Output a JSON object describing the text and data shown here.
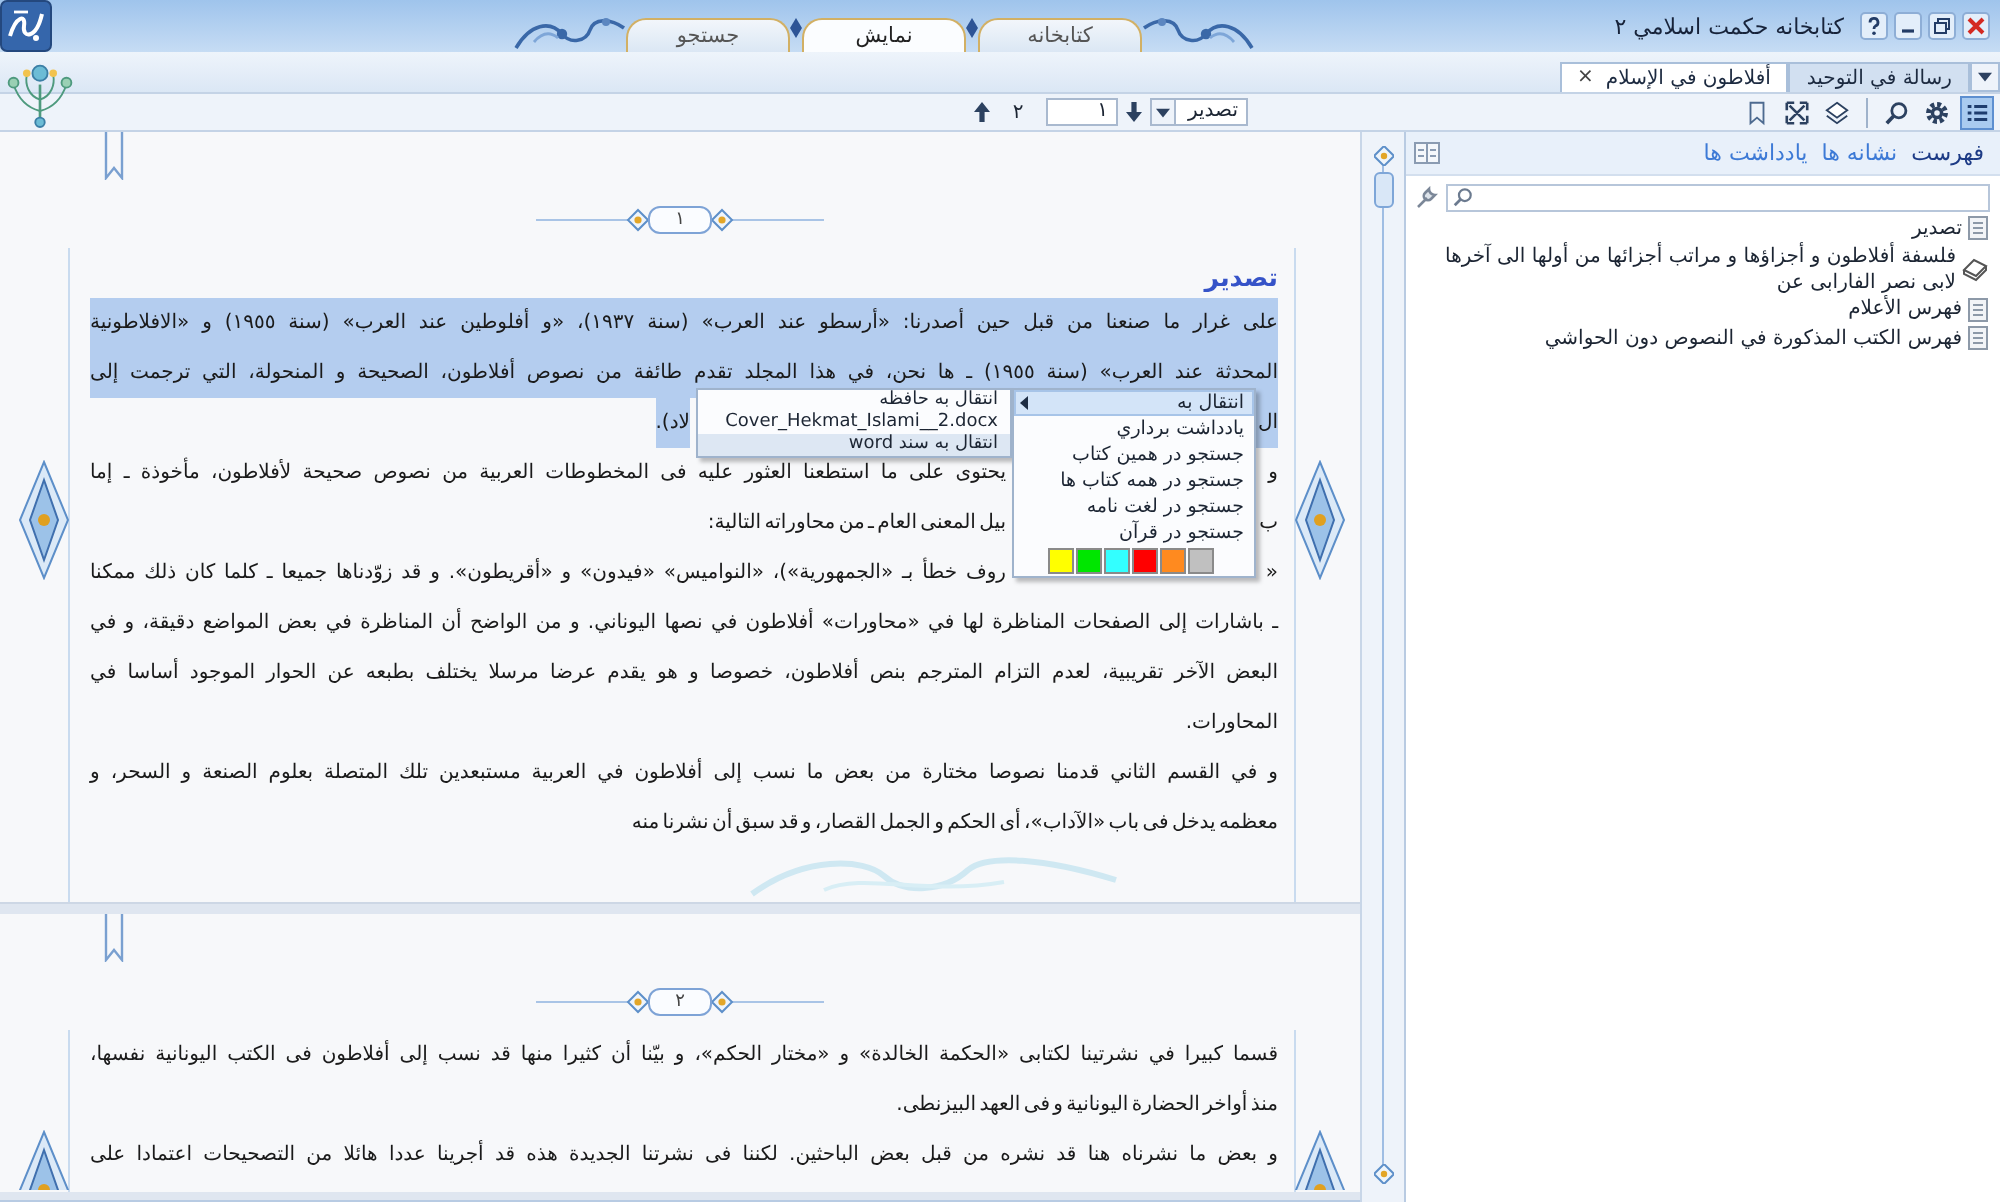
{
  "window": {
    "title": "كتابخانه حكمت اسلامي ٢"
  },
  "main_tabs": [
    {
      "label": "كتابخانه",
      "selected": false
    },
    {
      "label": "نمايش",
      "selected": true
    },
    {
      "label": "جستجو",
      "selected": false
    }
  ],
  "doc_tabs": [
    {
      "label": "رسالة في التوحيد",
      "selected": false
    },
    {
      "label": "أفلاطون في الإسلام",
      "selected": true,
      "close": "×"
    }
  ],
  "toolbar": {
    "page_count": "٢",
    "page": "١",
    "section": "تصدير",
    "tools": [
      {
        "kind": "bookmark",
        "selected": false
      },
      {
        "kind": "expand",
        "selected": false
      },
      {
        "kind": "layers",
        "selected": false
      },
      {
        "kind": "search",
        "selected": false
      },
      {
        "kind": "settings",
        "selected": false
      },
      {
        "kind": "list",
        "selected": true
      }
    ]
  },
  "pages": [
    {
      "number": "١",
      "heading": "تصدير",
      "paragraphs": [
        {
          "lines": [
            {
              "kind": "full",
              "selected": true,
              "text": "على غرار ما صنعنا من قبل حين أصدرنا: «أرسطو عند العرب» (سنة ١٩٣٧)، «و أفلوطين عند العرب» (سنة ١٩٥٥) و «الافلاطونية"
            },
            {
              "kind": "full",
              "selected": true,
              "text": "المحدثة عند العرب» (سنة ١٩٥٥) ـ ها نحن، في هذا المجلد تقدم طائفة من نصوص أفلاطون، الصحيحة و المنحولة، التي ترجمت إلى"
            },
            {
              "kind": "split-end-wide",
              "selected": true,
              "right": "ال",
              "left": "لاد)."
            }
          ]
        },
        {
          "lines": [
            {
              "kind": "split-full",
              "selected": false,
              "right": "و",
              "left": "يحتوى على ما استطعنا العثور عليه فى المخطوطات العربية من نصوص صحيحة لأفلاطون، مأخوذة ـ إما"
            },
            {
              "kind": "split-end",
              "selected": false,
              "right": "ب",
              "left": "بيل المعنى العام ـ من محاوراته التالية:"
            }
          ]
        },
        {
          "lines": [
            {
              "kind": "split-full",
              "selected": false,
              "right": "«",
              "left": "روف خطأ بـ «الجمهورية»)، «النواميس» «فيدون» و «أقريطون». و قد زوّدناها جميعا ـ كلما كان ذلك ممكنا"
            },
            {
              "kind": "full",
              "selected": false,
              "text": "ـ باشارات إلى الصفحات المناظرة لها في «محاورات» أفلاطون في نصها اليوناني. و من الواضح أن المناظرة في بعض المواضع دقيقة، و في"
            },
            {
              "kind": "full",
              "selected": false,
              "text": "البعض الآخر تقريبية، لعدم التزام المترجم بنص أفلاطون، خصوصا و هو يقدم عرضا مرسلا يختلف بطبعه عن الحوار الموجود أساسا في"
            },
            {
              "kind": "end",
              "selected": false,
              "text": "المحاورات."
            }
          ]
        },
        {
          "lines": [
            {
              "kind": "full",
              "selected": false,
              "text": "و في القسم الثاني قدمنا نصوصا مختارة من بعض ما نسب إلى أفلاطون في العربية مستبعدين تلك المتصلة بعلوم الصنعة و السحر، و"
            },
            {
              "kind": "end",
              "selected": false,
              "text": "معظمه يدخل فى باب «الآداب»، أى الحكم و الجمل القصار، و قد سبق أن نشرنا منه"
            }
          ]
        }
      ]
    },
    {
      "number": "٢",
      "paragraphs": [
        {
          "lines": [
            {
              "kind": "full",
              "selected": false,
              "text": "قسما كبيرا في نشرتينا لكتابى «الحكمة الخالدة» و «مختار الحكم»، و بيّنا أن كثيرا منها قد نسب إلى أفلاطون فى الكتب اليونانية نفسها،"
            },
            {
              "kind": "end",
              "selected": false,
              "text": "منذ أواخر الحضارة اليونانية و فى العهد البيزنطى."
            }
          ]
        },
        {
          "lines": [
            {
              "kind": "full",
              "selected": false,
              "text": "و بعض ما نشرناه هنا قد نشره من قبل بعض الباحثين. لكننا فى نشرتنا الجديدة هذه قد أجرينا عددا هائلا من التصحيحات اعتمادا على"
            }
          ]
        }
      ]
    }
  ],
  "context_menu": {
    "items": [
      {
        "label": "انتقال به",
        "kind": "submenu",
        "highlighted": true
      },
      {
        "label": "يادداشت برداري",
        "kind": "command",
        "highlighted": false
      },
      {
        "label": "جستجو در همين كتاب",
        "kind": "command",
        "highlighted": false
      },
      {
        "label": "جستجو در همه كتاب ها",
        "kind": "command",
        "highlighted": false
      },
      {
        "label": "جستجو در لغت نامه",
        "kind": "command",
        "highlighted": false
      },
      {
        "label": "جستجو در قرآن",
        "kind": "command",
        "highlighted": false
      }
    ],
    "swatches": [
      {
        "color": "#ffff00"
      },
      {
        "color": "#00e600"
      },
      {
        "color": "#33ffff"
      },
      {
        "color": "#ff0000"
      },
      {
        "color": "#ff8a1f"
      },
      {
        "color": "#c0c0c0"
      }
    ],
    "submenu": [
      {
        "label": "انتقال به حافظه",
        "highlighted": false
      },
      {
        "label": "Cover_Hekmat_Islami__2.docx",
        "highlighted": false
      },
      {
        "label": "انتقال به سند word",
        "highlighted": true
      }
    ]
  },
  "side_panel": {
    "tabs": [
      {
        "label": "فهرست",
        "selected": true
      },
      {
        "label": "نشانه ها",
        "selected": false
      },
      {
        "label": "يادداشت ها",
        "selected": false
      }
    ],
    "toc": [
      {
        "kind": "page",
        "label": "تصدير"
      },
      {
        "kind": "book",
        "label": "فلسفة أفلاطون و أجزاؤها و مراتب أجزائها من أولها الى آخرها لابى نصر الفارابى عن"
      },
      {
        "kind": "page",
        "label": "فهرس الأعلام"
      },
      {
        "kind": "page",
        "label": "فهرس الكتب المذكورة في النصوص دون الحواشي"
      }
    ]
  }
}
